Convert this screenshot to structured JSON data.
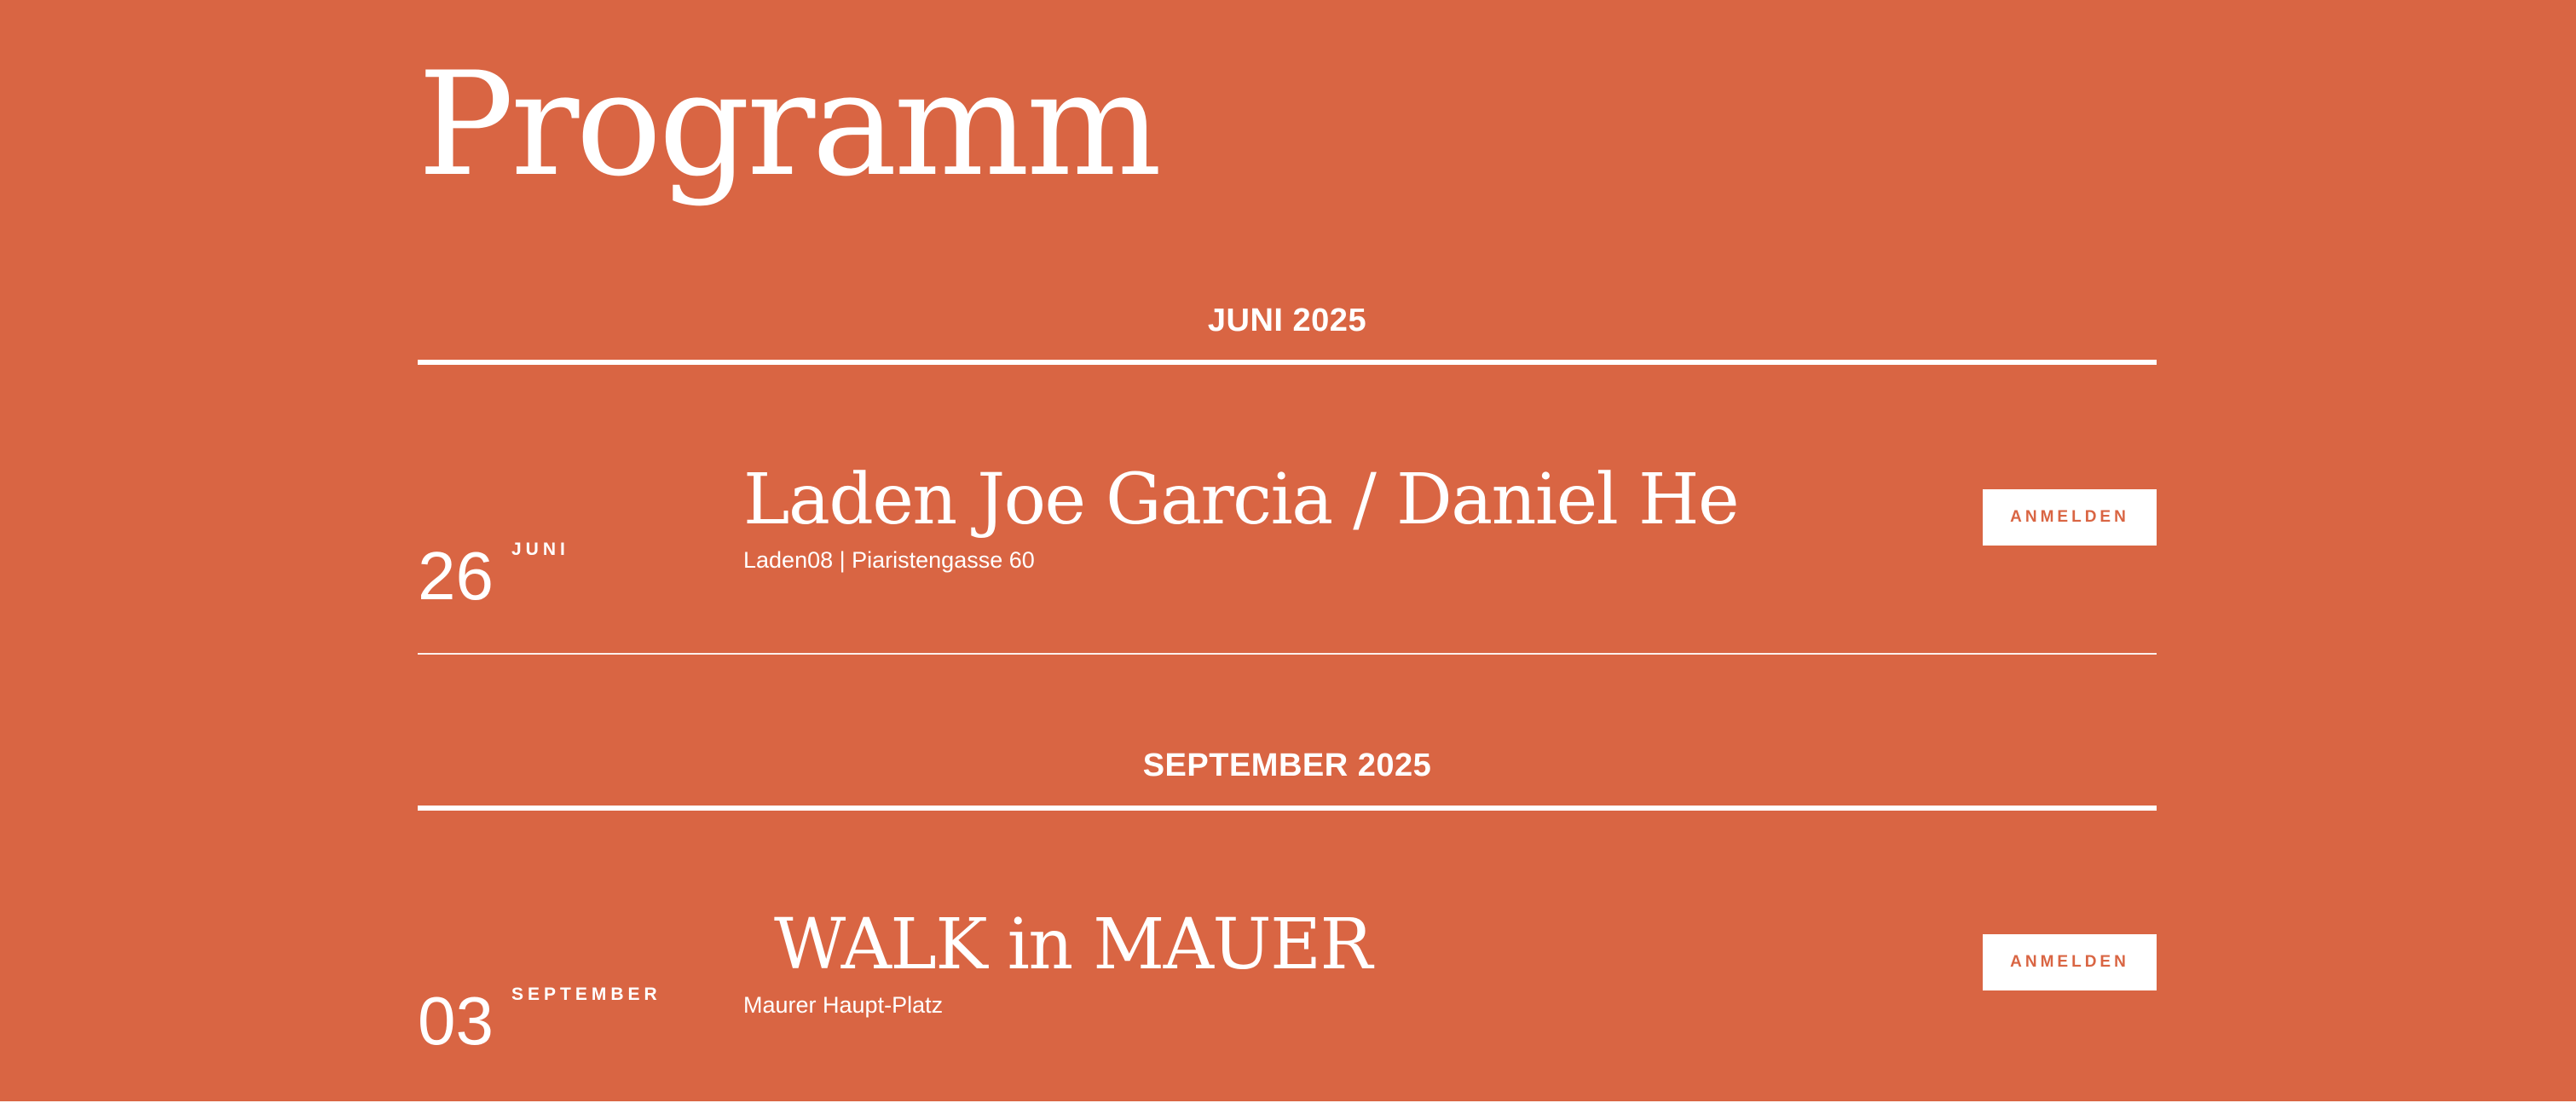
{
  "page": {
    "title": "Programm",
    "background_color": "#D96543",
    "text_color": "#FFFFFF"
  },
  "months": [
    {
      "label": "JUNI 2025",
      "events": [
        {
          "day": "26",
          "month": "JUNI",
          "title": "Laden Joe Garcia / Daniel He",
          "location": "Laden08 | Piaristengasse 60",
          "button_label": "ANMELDEN"
        }
      ]
    },
    {
      "label": "SEPTEMBER 2025",
      "events": [
        {
          "day": "03",
          "month": "SEPTEMBER",
          "title": "WALK in MAUER",
          "location": "Maurer Haupt-Platz",
          "button_label": "ANMELDEN"
        }
      ]
    }
  ]
}
